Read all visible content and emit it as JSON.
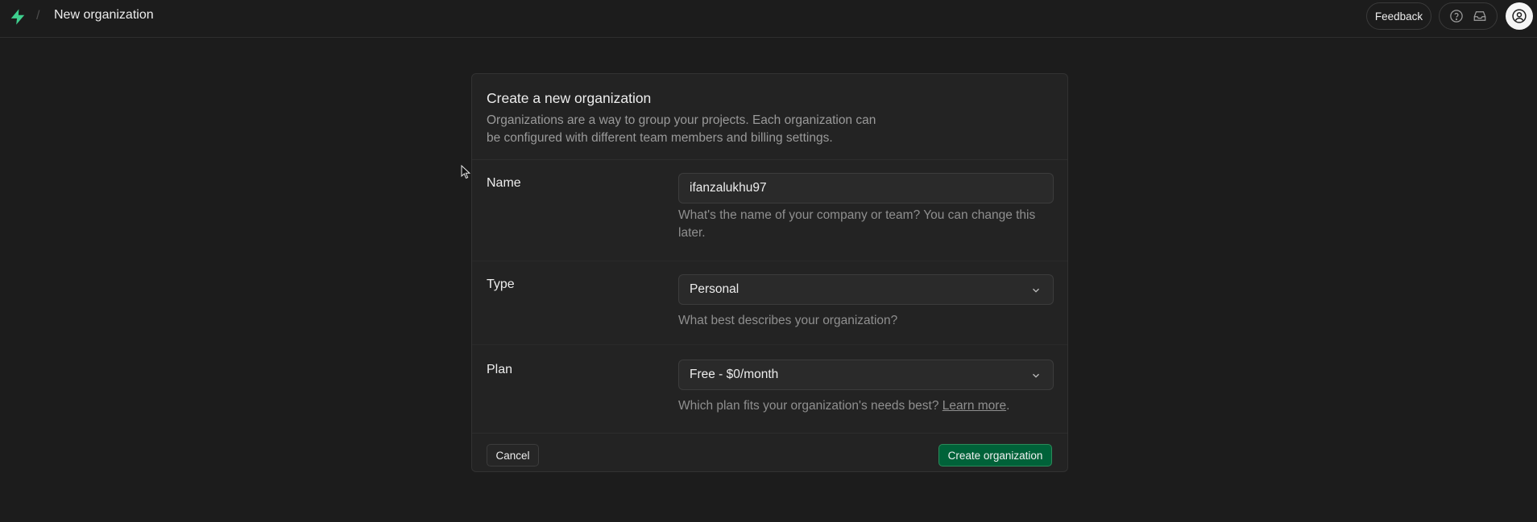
{
  "topbar": {
    "breadcrumb_title": "New organization",
    "separator": "/",
    "feedback_label": "Feedback",
    "icons": [
      "logo-icon",
      "help-icon",
      "inbox-icon",
      "user-avatar-icon"
    ]
  },
  "form": {
    "title": "Create a new organization",
    "description": "Organizations are a way to group your projects. Each organization can be configured with different team members and billing settings.",
    "name": {
      "label": "Name",
      "value": "ifanzalukhu97",
      "help": "What's the name of your company or team? You can change this later."
    },
    "type": {
      "label": "Type",
      "value": "Personal",
      "help": "What best describes your organization?"
    },
    "plan": {
      "label": "Plan",
      "value": "Free - $0/month",
      "help_prefix": "Which plan fits your organization's needs best?",
      "help_link": "Learn more",
      "help_suffix": "."
    },
    "cancel_label": "Cancel",
    "submit_label": "Create organization"
  },
  "colors": {
    "background": "#1c1c1c",
    "card": "#232323",
    "brand_green": "#3ecf8e",
    "primary_button": "#006239"
  }
}
